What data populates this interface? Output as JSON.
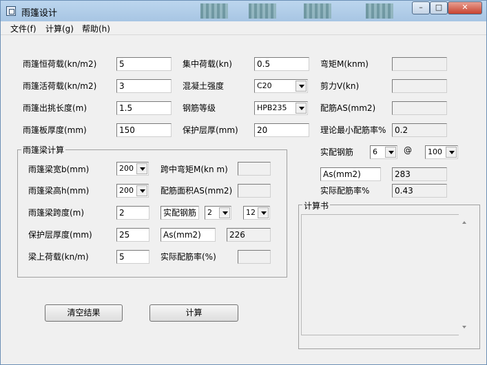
{
  "window": {
    "title": "雨篷设计",
    "min_label": "–",
    "max_label": "□",
    "close_label": "✕"
  },
  "menu": [
    "文件(f)",
    "计算(g)",
    "帮助(h)"
  ],
  "slab": {
    "dead_load_label": "雨篷恒荷载(kn/m2)",
    "dead_load_value": "5",
    "live_load_label": "雨篷活荷载(kn/m2)",
    "live_load_value": "3",
    "cantilever_label": "雨篷出挑长度(m)",
    "cantilever_value": "1.5",
    "thickness_label": "雨篷板厚度(mm)",
    "thickness_value": "150",
    "point_load_label": "集中荷载(kn)",
    "point_load_value": "0.5",
    "concrete_label": "混凝土强度",
    "concrete_value": "C20",
    "steel_label": "钢筋等级",
    "steel_value": "HPB235",
    "cover_label": "保护层厚(mm)",
    "cover_value": "20",
    "moment_label": "弯矩M(knm)",
    "moment_value": "",
    "shear_label": "剪力V(kn)",
    "shear_value": "",
    "as_label": "配筋AS(mm2)",
    "as_value": "",
    "min_ratio_label": "理论最小配筋率%",
    "min_ratio_value": "0.2",
    "actual_steel_label": "实配钢筋",
    "bar_diameter": "6",
    "at_symbol": "@",
    "bar_spacing": "100",
    "as_result_label": "As(mm2)",
    "as_result_value": "283",
    "actual_ratio_label": "实际配筋率%",
    "actual_ratio_value": "0.43"
  },
  "beam": {
    "group_title": "雨篷梁计算",
    "width_label": "雨篷梁宽b(mm)",
    "width_value": "200",
    "height_label": "雨篷梁高h(mm)",
    "height_value": "200",
    "span_label": "雨篷梁跨度(m)",
    "span_value": "2",
    "cover_label": "保护层厚度(mm)",
    "cover_value": "25",
    "load_label": "梁上荷载(kn/m)",
    "load_value": "5",
    "midspan_moment_label": "跨中弯矩M(kn m)",
    "midspan_moment_value": "",
    "area_label": "配筋面积AS(mm2)",
    "area_value": "",
    "actual_steel_label": "实配钢筋",
    "bar_count": "2",
    "bar_diameter": "12",
    "as_label": "As(mm2)",
    "as_value": "226",
    "actual_ratio_label": "实际配筋率(%)",
    "actual_ratio_value": ""
  },
  "calc_book": {
    "title": "计算书",
    "content": ""
  },
  "buttons": {
    "clear": "清空结果",
    "calculate": "计算"
  }
}
